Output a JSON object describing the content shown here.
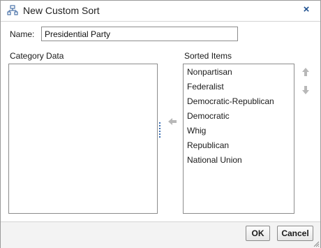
{
  "dialog": {
    "title": "New Custom Sort",
    "title_icon": "hierarchy-icon",
    "close_label": "×"
  },
  "name_field": {
    "label": "Name:",
    "value": "Presidential Party"
  },
  "category_data": {
    "label": "Category Data",
    "items": []
  },
  "sorted_items": {
    "label": "Sorted Items",
    "items": [
      "Nonpartisan",
      "Federalist",
      "Democratic-Republican",
      "Democratic",
      "Whig",
      "Republican",
      "National Union"
    ]
  },
  "buttons": {
    "ok": "OK",
    "cancel": "Cancel"
  },
  "colors": {
    "accent": "#1d4f8f",
    "arrow_gray": "#b8b8b8",
    "footer_bg": "#f3f3f3"
  }
}
